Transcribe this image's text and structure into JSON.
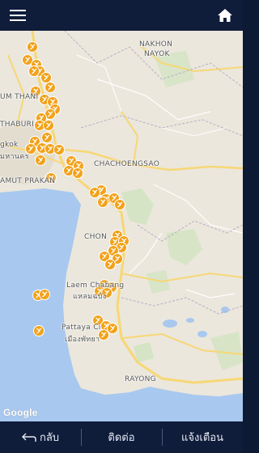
{
  "header": {
    "menu_icon": "hamburger-menu-icon",
    "home_icon": "home-icon"
  },
  "colors": {
    "bar": "#0f1c3a",
    "marker": "#f2a21b",
    "sea": "#a8c8ef",
    "land": "#ebe7dc",
    "park": "#c6e3b4",
    "highway": "#f7d775"
  },
  "map": {
    "labels": {
      "nakhon_nayok_1": "NAKHON",
      "nakhon_nayok_2": "NAYOK",
      "um_thani": "UM THANI",
      "thaburi": "THABURI",
      "gkok": "gkok",
      "mahanakhon": "มหานคร",
      "amut_prakan": "AMUT PRAKAN",
      "chachoengsao": "CHACHOENGSAO",
      "chon": "CHON",
      "laem_chabang_en": "Laem Chabang",
      "laem_chabang_th": "แหลมฉบัง",
      "pattaya_en": "Pattaya Ci",
      "pattaya_th": "เมืองพัทยา",
      "rayong": "RAYONG",
      "google": "Google"
    },
    "marker_count": 52
  },
  "footer": {
    "back_label": "กลับ",
    "contact_label": "ติดต่อ",
    "notify_label": "แจ้งเตือน"
  }
}
